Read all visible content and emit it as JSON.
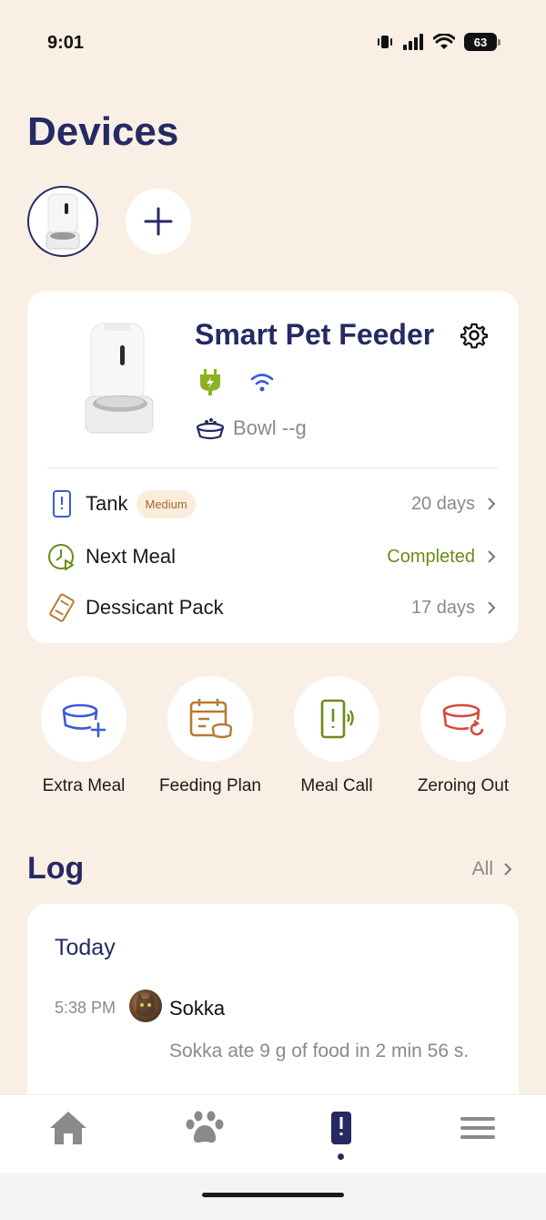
{
  "status_bar": {
    "time": "9:01",
    "battery": "63"
  },
  "page": {
    "title": "Devices"
  },
  "device": {
    "name": "Smart Pet Feeder",
    "bowl": "Bowl --g",
    "rows": [
      {
        "label": "Tank",
        "badge": "Medium",
        "value": "20 days",
        "icon": "tank-icon"
      },
      {
        "label": "Next Meal",
        "value": "Completed",
        "icon": "clock-icon"
      },
      {
        "label": "Dessicant Pack",
        "value": "17 days",
        "icon": "desiccant-icon"
      }
    ]
  },
  "actions": [
    {
      "label": "Extra Meal",
      "icon": "bowl-plus-icon"
    },
    {
      "label": "Feeding Plan",
      "icon": "calendar-icon"
    },
    {
      "label": "Meal Call",
      "icon": "sound-device-icon"
    },
    {
      "label": "Zeroing Out",
      "icon": "bowl-reset-icon"
    }
  ],
  "log": {
    "title": "Log",
    "all_label": "All",
    "day": "Today",
    "entry": {
      "time": "5:38 PM",
      "pet": "Sokka",
      "text": "Sokka ate 9 g of food in 2 min 56 s."
    }
  },
  "tabs": [
    {
      "name": "home",
      "icon": "home-icon"
    },
    {
      "name": "pets",
      "icon": "paw-icon"
    },
    {
      "name": "devices",
      "icon": "feeder-icon",
      "active": true
    },
    {
      "name": "menu",
      "icon": "menu-icon"
    }
  ],
  "colors": {
    "background": "#f9efe4",
    "primary": "#252a63",
    "green": "#6a8c17",
    "orange": "#b87a32",
    "red": "#d44a3d",
    "blue": "#3c5ad6"
  }
}
